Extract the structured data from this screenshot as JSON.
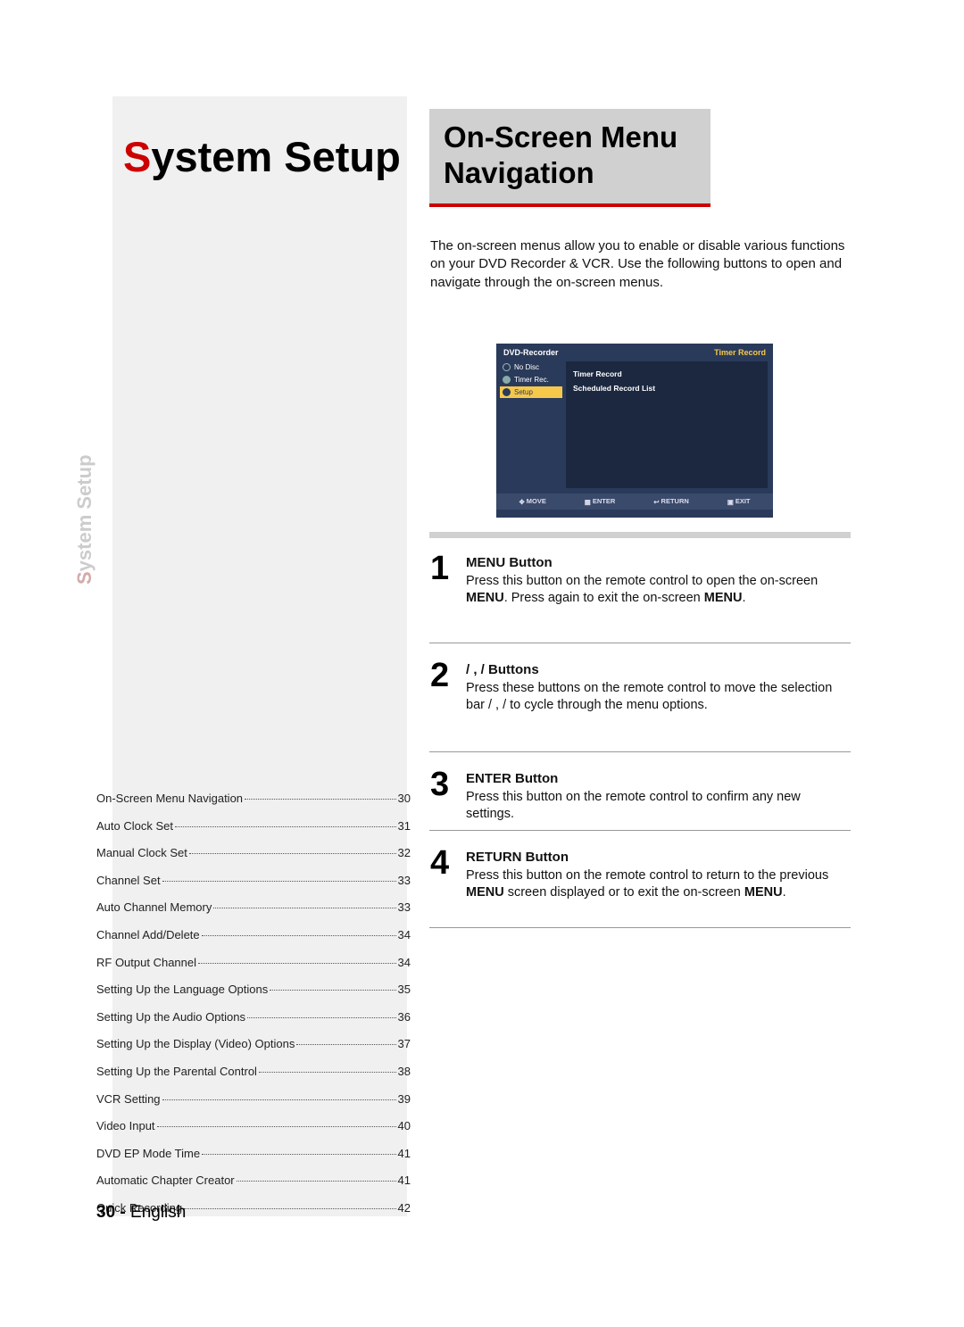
{
  "main_title_first": "S",
  "main_title_rest": "ystem Setup",
  "side_tab_first": "S",
  "side_tab_rest": "ystem Setup",
  "section_title_l1": "On-Screen Menu",
  "section_title_l2": "Navigation",
  "intro_text": "The on-screen menus allow you to enable or disable various functions on your DVD Recorder & VCR. Use the following buttons to open and navigate through the on-screen menus.",
  "screen": {
    "header_left": "DVD-Recorder",
    "header_right": "Timer Record",
    "left_items": [
      {
        "label": "No Disc"
      },
      {
        "label": "Timer Rec."
      },
      {
        "label": "Setup"
      }
    ],
    "right_items": [
      "Timer Record",
      "Scheduled Record List"
    ],
    "footer": {
      "move": "MOVE",
      "enter": "ENTER",
      "return": "RETURN",
      "exit": "EXIT"
    }
  },
  "steps": [
    {
      "num": "1",
      "heading": "MENU Button",
      "text_before": "Press this button on the remote control to open the on-screen ",
      "bold1": "MENU",
      "text_mid": ". Press again to exit the on-screen ",
      "bold2": "MENU",
      "text_after": "."
    },
    {
      "num": "2",
      "heading_pre": "  /   ,   /    Buttons",
      "text": "Press these buttons on the remote control to move the selection bar    /   ,   /    to cycle through the menu options."
    },
    {
      "num": "3",
      "heading": "ENTER Button",
      "text": "Press this button on the remote control to confirm any new settings."
    },
    {
      "num": "4",
      "heading": "RETURN Button",
      "text_before": "Press this button on the remote control to return to the previous ",
      "bold1": "MENU",
      "text_mid": " screen displayed or to exit the on-screen ",
      "bold2": "MENU",
      "text_after": "."
    }
  ],
  "toc": [
    {
      "label": "On-Screen Menu Navigation",
      "page": "30"
    },
    {
      "label": "Auto Clock Set",
      "page": "31"
    },
    {
      "label": "Manual Clock Set",
      "page": "32"
    },
    {
      "label": "Channel Set",
      "page": "33"
    },
    {
      "label": "Auto Channel Memory",
      "page": "33"
    },
    {
      "label": "Channel Add/Delete",
      "page": "34"
    },
    {
      "label": "RF Output Channel",
      "page": "34"
    },
    {
      "label": "Setting Up the Language Options",
      "page": "35"
    },
    {
      "label": "Setting Up the Audio Options",
      "page": "36"
    },
    {
      "label": "Setting Up the Display (Video) Options",
      "page": "37"
    },
    {
      "label": "Setting Up the Parental Control",
      "page": "38"
    },
    {
      "label": "VCR Setting",
      "page": "39"
    },
    {
      "label": "Video Input",
      "page": "40"
    },
    {
      "label": "DVD EP Mode Time",
      "page": "41"
    },
    {
      "label": "Automatic Chapter Creator",
      "page": "41"
    },
    {
      "label": "Quick Recording",
      "page": "42"
    }
  ],
  "footer_page": "30 -",
  "footer_lang": " English"
}
